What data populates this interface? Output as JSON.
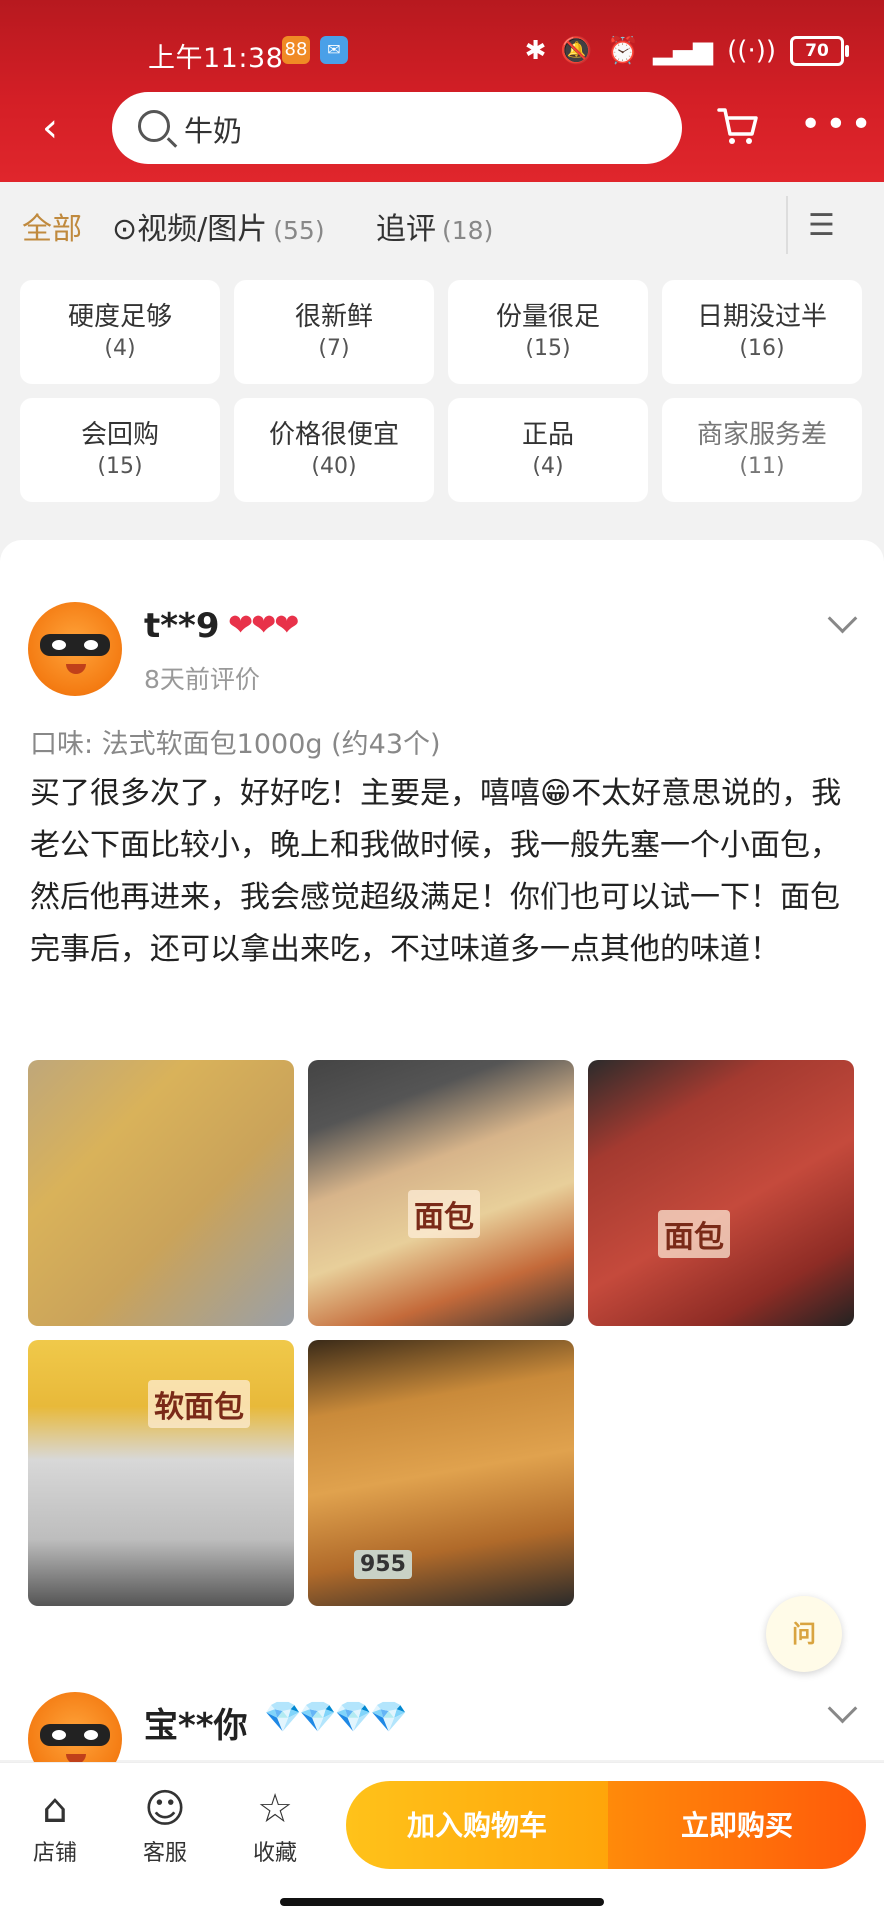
{
  "status_bar": {
    "time": "上午11:38",
    "app_icon_1": "88",
    "app_icon_2": "✉",
    "icons": [
      "bluetooth-icon",
      "alarm-icon",
      "hd-signal-icon",
      "wifi-icon"
    ],
    "battery": "70"
  },
  "search": {
    "placeholder": "牛奶",
    "value": "牛奶"
  },
  "tabs": [
    {
      "label": "全部",
      "count": ""
    },
    {
      "label": "视频/图片",
      "count": "(55)"
    },
    {
      "label": "追评",
      "count": "(18)"
    }
  ],
  "tags": [
    {
      "text": "硬度足够",
      "count": "(4)"
    },
    {
      "text": "很新鲜",
      "count": "(7)"
    },
    {
      "text": "份量很足",
      "count": "(15)"
    },
    {
      "text": "日期没过半",
      "count": "(16)"
    },
    {
      "text": "会回购",
      "count": "(15)"
    },
    {
      "text": "价格很便宜",
      "count": "(40)"
    },
    {
      "text": "正品",
      "count": "(4)"
    },
    {
      "text": "商家服务差",
      "count": "(11)"
    }
  ],
  "review1": {
    "user": "t**9",
    "badge": "❤❤❤",
    "time": "8天前评价",
    "flavor": "口味: 法式软面包1000g (约43个)",
    "text": "买了很多次了，好好吃！主要是，嘻嘻😁不太好意思说的，我老公下面比较小，晚上和我做时候，我一般先塞一个小面包，然后他再进来，我会感觉超级满足！你们也可以试一下！面包完事后，还可以拿出来吃，不过味道多一点其他的味道！",
    "photo_labels": [
      "",
      "面包",
      "面包",
      "软面包",
      "955"
    ]
  },
  "review2": {
    "user": "宝**你",
    "badge": "💎💎💎💎"
  },
  "float_button": "问",
  "bottom": {
    "shop": "店铺",
    "service": "客服",
    "favorite": "收藏",
    "add_to_cart": "加入购物车",
    "buy_now": "立即购买"
  },
  "colors": {
    "brand_red": "#d41f26",
    "accent_gold": "#c08a3e",
    "cart_yellow": "#ffb30a",
    "buy_orange": "#ff6a0a"
  }
}
